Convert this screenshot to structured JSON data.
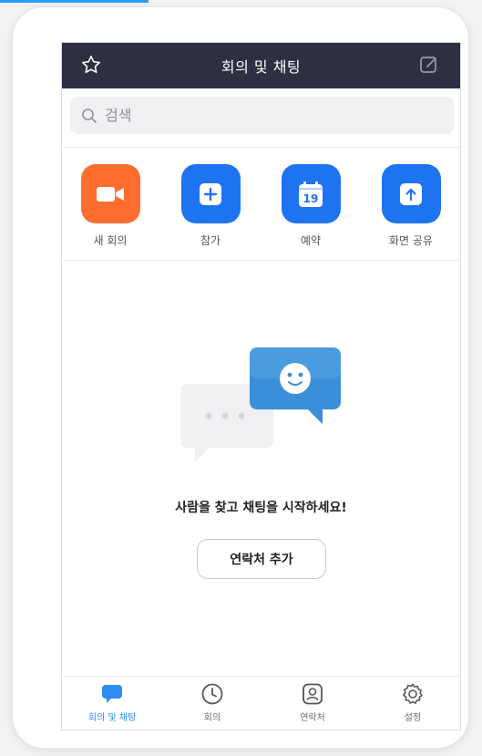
{
  "header": {
    "title": "회의 및 채팅",
    "left_icon": "star-icon",
    "right_icon": "compose-icon"
  },
  "search": {
    "placeholder": "검색"
  },
  "actions": [
    {
      "label": "새 회의",
      "icon": "video-camera-icon",
      "color": "#ff6d2e"
    },
    {
      "label": "참가",
      "icon": "plus-icon",
      "color": "#1e73f0"
    },
    {
      "label": "예약",
      "icon": "calendar-icon",
      "color": "#1e73f0",
      "badge": "19"
    },
    {
      "label": "화면 공유",
      "icon": "share-screen-icon",
      "color": "#1e73f0"
    }
  ],
  "empty_state": {
    "message": "사람을 찾고 채팅을 시작하세요!",
    "button_label": "연락처 추가"
  },
  "tabs": [
    {
      "label": "회의 및 채팅",
      "icon": "chat-bubble-icon",
      "active": true
    },
    {
      "label": "회의",
      "icon": "clock-icon",
      "active": false
    },
    {
      "label": "연락처",
      "icon": "contact-icon",
      "active": false
    },
    {
      "label": "설정",
      "icon": "gear-icon",
      "active": false
    }
  ],
  "colors": {
    "header_bg": "#2d2f43",
    "accent": "#2d8cf0",
    "new_meeting": "#ff6d2e",
    "action_blue": "#1e73f0"
  }
}
